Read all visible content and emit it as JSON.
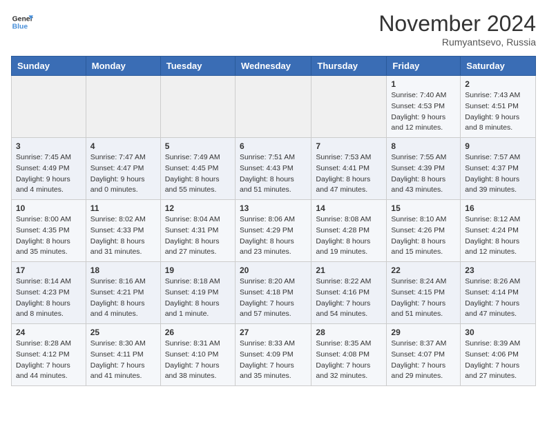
{
  "header": {
    "logo_line1": "General",
    "logo_line2": "Blue",
    "month": "November 2024",
    "location": "Rumyantsevo, Russia"
  },
  "weekdays": [
    "Sunday",
    "Monday",
    "Tuesday",
    "Wednesday",
    "Thursday",
    "Friday",
    "Saturday"
  ],
  "weeks": [
    [
      {
        "day": "",
        "info": ""
      },
      {
        "day": "",
        "info": ""
      },
      {
        "day": "",
        "info": ""
      },
      {
        "day": "",
        "info": ""
      },
      {
        "day": "",
        "info": ""
      },
      {
        "day": "1",
        "info": "Sunrise: 7:40 AM\nSunset: 4:53 PM\nDaylight: 9 hours and 12 minutes."
      },
      {
        "day": "2",
        "info": "Sunrise: 7:43 AM\nSunset: 4:51 PM\nDaylight: 9 hours and 8 minutes."
      }
    ],
    [
      {
        "day": "3",
        "info": "Sunrise: 7:45 AM\nSunset: 4:49 PM\nDaylight: 9 hours and 4 minutes."
      },
      {
        "day": "4",
        "info": "Sunrise: 7:47 AM\nSunset: 4:47 PM\nDaylight: 9 hours and 0 minutes."
      },
      {
        "day": "5",
        "info": "Sunrise: 7:49 AM\nSunset: 4:45 PM\nDaylight: 8 hours and 55 minutes."
      },
      {
        "day": "6",
        "info": "Sunrise: 7:51 AM\nSunset: 4:43 PM\nDaylight: 8 hours and 51 minutes."
      },
      {
        "day": "7",
        "info": "Sunrise: 7:53 AM\nSunset: 4:41 PM\nDaylight: 8 hours and 47 minutes."
      },
      {
        "day": "8",
        "info": "Sunrise: 7:55 AM\nSunset: 4:39 PM\nDaylight: 8 hours and 43 minutes."
      },
      {
        "day": "9",
        "info": "Sunrise: 7:57 AM\nSunset: 4:37 PM\nDaylight: 8 hours and 39 minutes."
      }
    ],
    [
      {
        "day": "10",
        "info": "Sunrise: 8:00 AM\nSunset: 4:35 PM\nDaylight: 8 hours and 35 minutes."
      },
      {
        "day": "11",
        "info": "Sunrise: 8:02 AM\nSunset: 4:33 PM\nDaylight: 8 hours and 31 minutes."
      },
      {
        "day": "12",
        "info": "Sunrise: 8:04 AM\nSunset: 4:31 PM\nDaylight: 8 hours and 27 minutes."
      },
      {
        "day": "13",
        "info": "Sunrise: 8:06 AM\nSunset: 4:29 PM\nDaylight: 8 hours and 23 minutes."
      },
      {
        "day": "14",
        "info": "Sunrise: 8:08 AM\nSunset: 4:28 PM\nDaylight: 8 hours and 19 minutes."
      },
      {
        "day": "15",
        "info": "Sunrise: 8:10 AM\nSunset: 4:26 PM\nDaylight: 8 hours and 15 minutes."
      },
      {
        "day": "16",
        "info": "Sunrise: 8:12 AM\nSunset: 4:24 PM\nDaylight: 8 hours and 12 minutes."
      }
    ],
    [
      {
        "day": "17",
        "info": "Sunrise: 8:14 AM\nSunset: 4:23 PM\nDaylight: 8 hours and 8 minutes."
      },
      {
        "day": "18",
        "info": "Sunrise: 8:16 AM\nSunset: 4:21 PM\nDaylight: 8 hours and 4 minutes."
      },
      {
        "day": "19",
        "info": "Sunrise: 8:18 AM\nSunset: 4:19 PM\nDaylight: 8 hours and 1 minute."
      },
      {
        "day": "20",
        "info": "Sunrise: 8:20 AM\nSunset: 4:18 PM\nDaylight: 7 hours and 57 minutes."
      },
      {
        "day": "21",
        "info": "Sunrise: 8:22 AM\nSunset: 4:16 PM\nDaylight: 7 hours and 54 minutes."
      },
      {
        "day": "22",
        "info": "Sunrise: 8:24 AM\nSunset: 4:15 PM\nDaylight: 7 hours and 51 minutes."
      },
      {
        "day": "23",
        "info": "Sunrise: 8:26 AM\nSunset: 4:14 PM\nDaylight: 7 hours and 47 minutes."
      }
    ],
    [
      {
        "day": "24",
        "info": "Sunrise: 8:28 AM\nSunset: 4:12 PM\nDaylight: 7 hours and 44 minutes."
      },
      {
        "day": "25",
        "info": "Sunrise: 8:30 AM\nSunset: 4:11 PM\nDaylight: 7 hours and 41 minutes."
      },
      {
        "day": "26",
        "info": "Sunrise: 8:31 AM\nSunset: 4:10 PM\nDaylight: 7 hours and 38 minutes."
      },
      {
        "day": "27",
        "info": "Sunrise: 8:33 AM\nSunset: 4:09 PM\nDaylight: 7 hours and 35 minutes."
      },
      {
        "day": "28",
        "info": "Sunrise: 8:35 AM\nSunset: 4:08 PM\nDaylight: 7 hours and 32 minutes."
      },
      {
        "day": "29",
        "info": "Sunrise: 8:37 AM\nSunset: 4:07 PM\nDaylight: 7 hours and 29 minutes."
      },
      {
        "day": "30",
        "info": "Sunrise: 8:39 AM\nSunset: 4:06 PM\nDaylight: 7 hours and 27 minutes."
      }
    ]
  ]
}
